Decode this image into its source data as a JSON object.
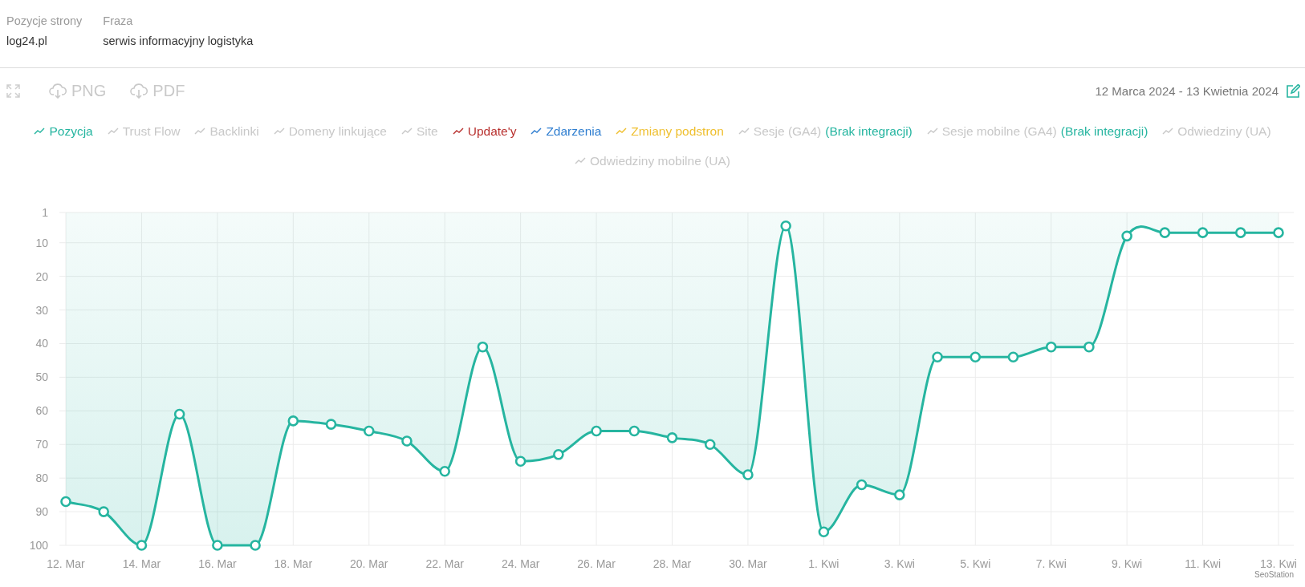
{
  "header": {
    "fields": [
      {
        "label": "Pozycje strony",
        "value": "log24.pl"
      },
      {
        "label": "Fraza",
        "value": "serwis informacyjny logistyka"
      }
    ]
  },
  "toolbar": {
    "exports": [
      "PNG",
      "PDF"
    ],
    "date_range": "12 Marca 2024 - 13 Kwietnia 2024"
  },
  "legend": {
    "items": [
      {
        "label": "Pozycja",
        "enabled": true,
        "color": "#26b5a0"
      },
      {
        "label": "Trust Flow",
        "enabled": false
      },
      {
        "label": "Backlinki",
        "enabled": false
      },
      {
        "label": "Domeny linkujące",
        "enabled": false
      },
      {
        "label": "Site",
        "enabled": false
      },
      {
        "label": "Update'y",
        "enabled": true,
        "color": "#b8312f"
      },
      {
        "label": "Zdarzenia",
        "enabled": true,
        "color": "#2f7ed0"
      },
      {
        "label": "Zmiany podstron",
        "enabled": true,
        "color": "#efbf2e"
      },
      {
        "label": "Sesje (GA4)",
        "enabled": false,
        "note": "(Brak integracji)"
      },
      {
        "label": "Sesje mobilne (GA4)",
        "enabled": false,
        "note": "(Brak integracji)"
      },
      {
        "label": "Odwiedziny (UA)",
        "enabled": false
      },
      {
        "label": "Odwiedziny mobilne (UA)",
        "enabled": false
      }
    ]
  },
  "chart": {
    "chart_data": {
      "type": "area",
      "categories": [
        "12. Mar",
        null,
        "14. Mar",
        null,
        "16. Mar",
        null,
        "18. Mar",
        null,
        "20. Mar",
        null,
        "22. Mar",
        null,
        "24. Mar",
        null,
        "26. Mar",
        null,
        "28. Mar",
        null,
        "30. Mar",
        null,
        "1. Kwi",
        null,
        "3. Kwi",
        null,
        "5. Kwi",
        null,
        "7. Kwi",
        null,
        "9. Kwi",
        null,
        "11. Kwi",
        null,
        "13. Kwi"
      ],
      "series": [
        {
          "color": "#26b5a0",
          "values": [
            87,
            90,
            100,
            61,
            100,
            100,
            63,
            64,
            66,
            69,
            78,
            41,
            75,
            73,
            66,
            66,
            68,
            70,
            79,
            5,
            96,
            82,
            85,
            44,
            44,
            44,
            41,
            41,
            8,
            7,
            7,
            7,
            7
          ]
        }
      ],
      "ylim": [
        100,
        1
      ],
      "grid": true,
      "yticks": [
        1,
        10,
        20,
        30,
        40,
        50,
        60,
        70,
        80,
        90,
        100
      ]
    },
    "credit": "SeoStation"
  }
}
